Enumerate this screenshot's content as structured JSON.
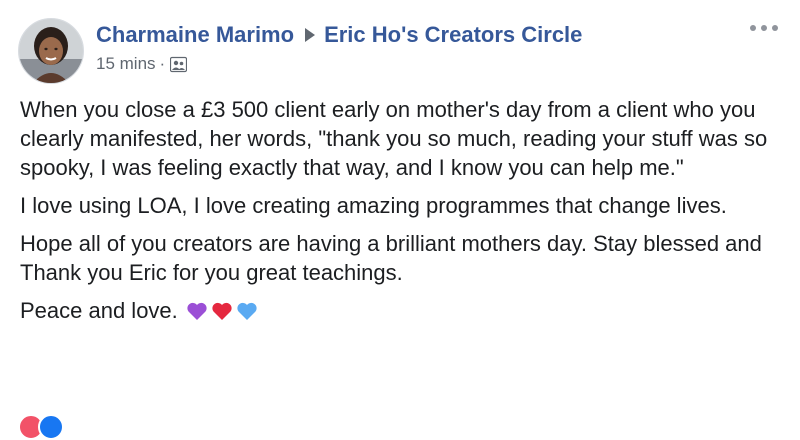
{
  "post": {
    "author": "Charmaine Marimo",
    "group": "Eric Ho's Creators Circle",
    "timestamp": "15 mins",
    "separator": "·",
    "privacy_icon": "group-icon",
    "more_icon": "ellipsis-icon",
    "paragraphs": [
      "When you close a £3 500 client early on mother's day from a client who you clearly manifested, her words, \"thank you so much, reading your stuff was so spooky, I was feeling exactly that way, and I know you can help me.\"",
      "I love using LOA, I love creating amazing programmes that change lives.",
      "Hope all of you creators are having a brilliant mothers day. Stay blessed and Thank you Eric for you great teachings.",
      "Peace and love."
    ],
    "emoji_hearts": [
      "purple-heart",
      "red-heart",
      "blue-heart"
    ],
    "colors": {
      "name_link": "#365899",
      "text": "#1c1e21",
      "meta": "#606770",
      "purple_heart": "#9b4fd6",
      "red_heart": "#e5283f",
      "blue_heart": "#5aaaf2"
    }
  }
}
